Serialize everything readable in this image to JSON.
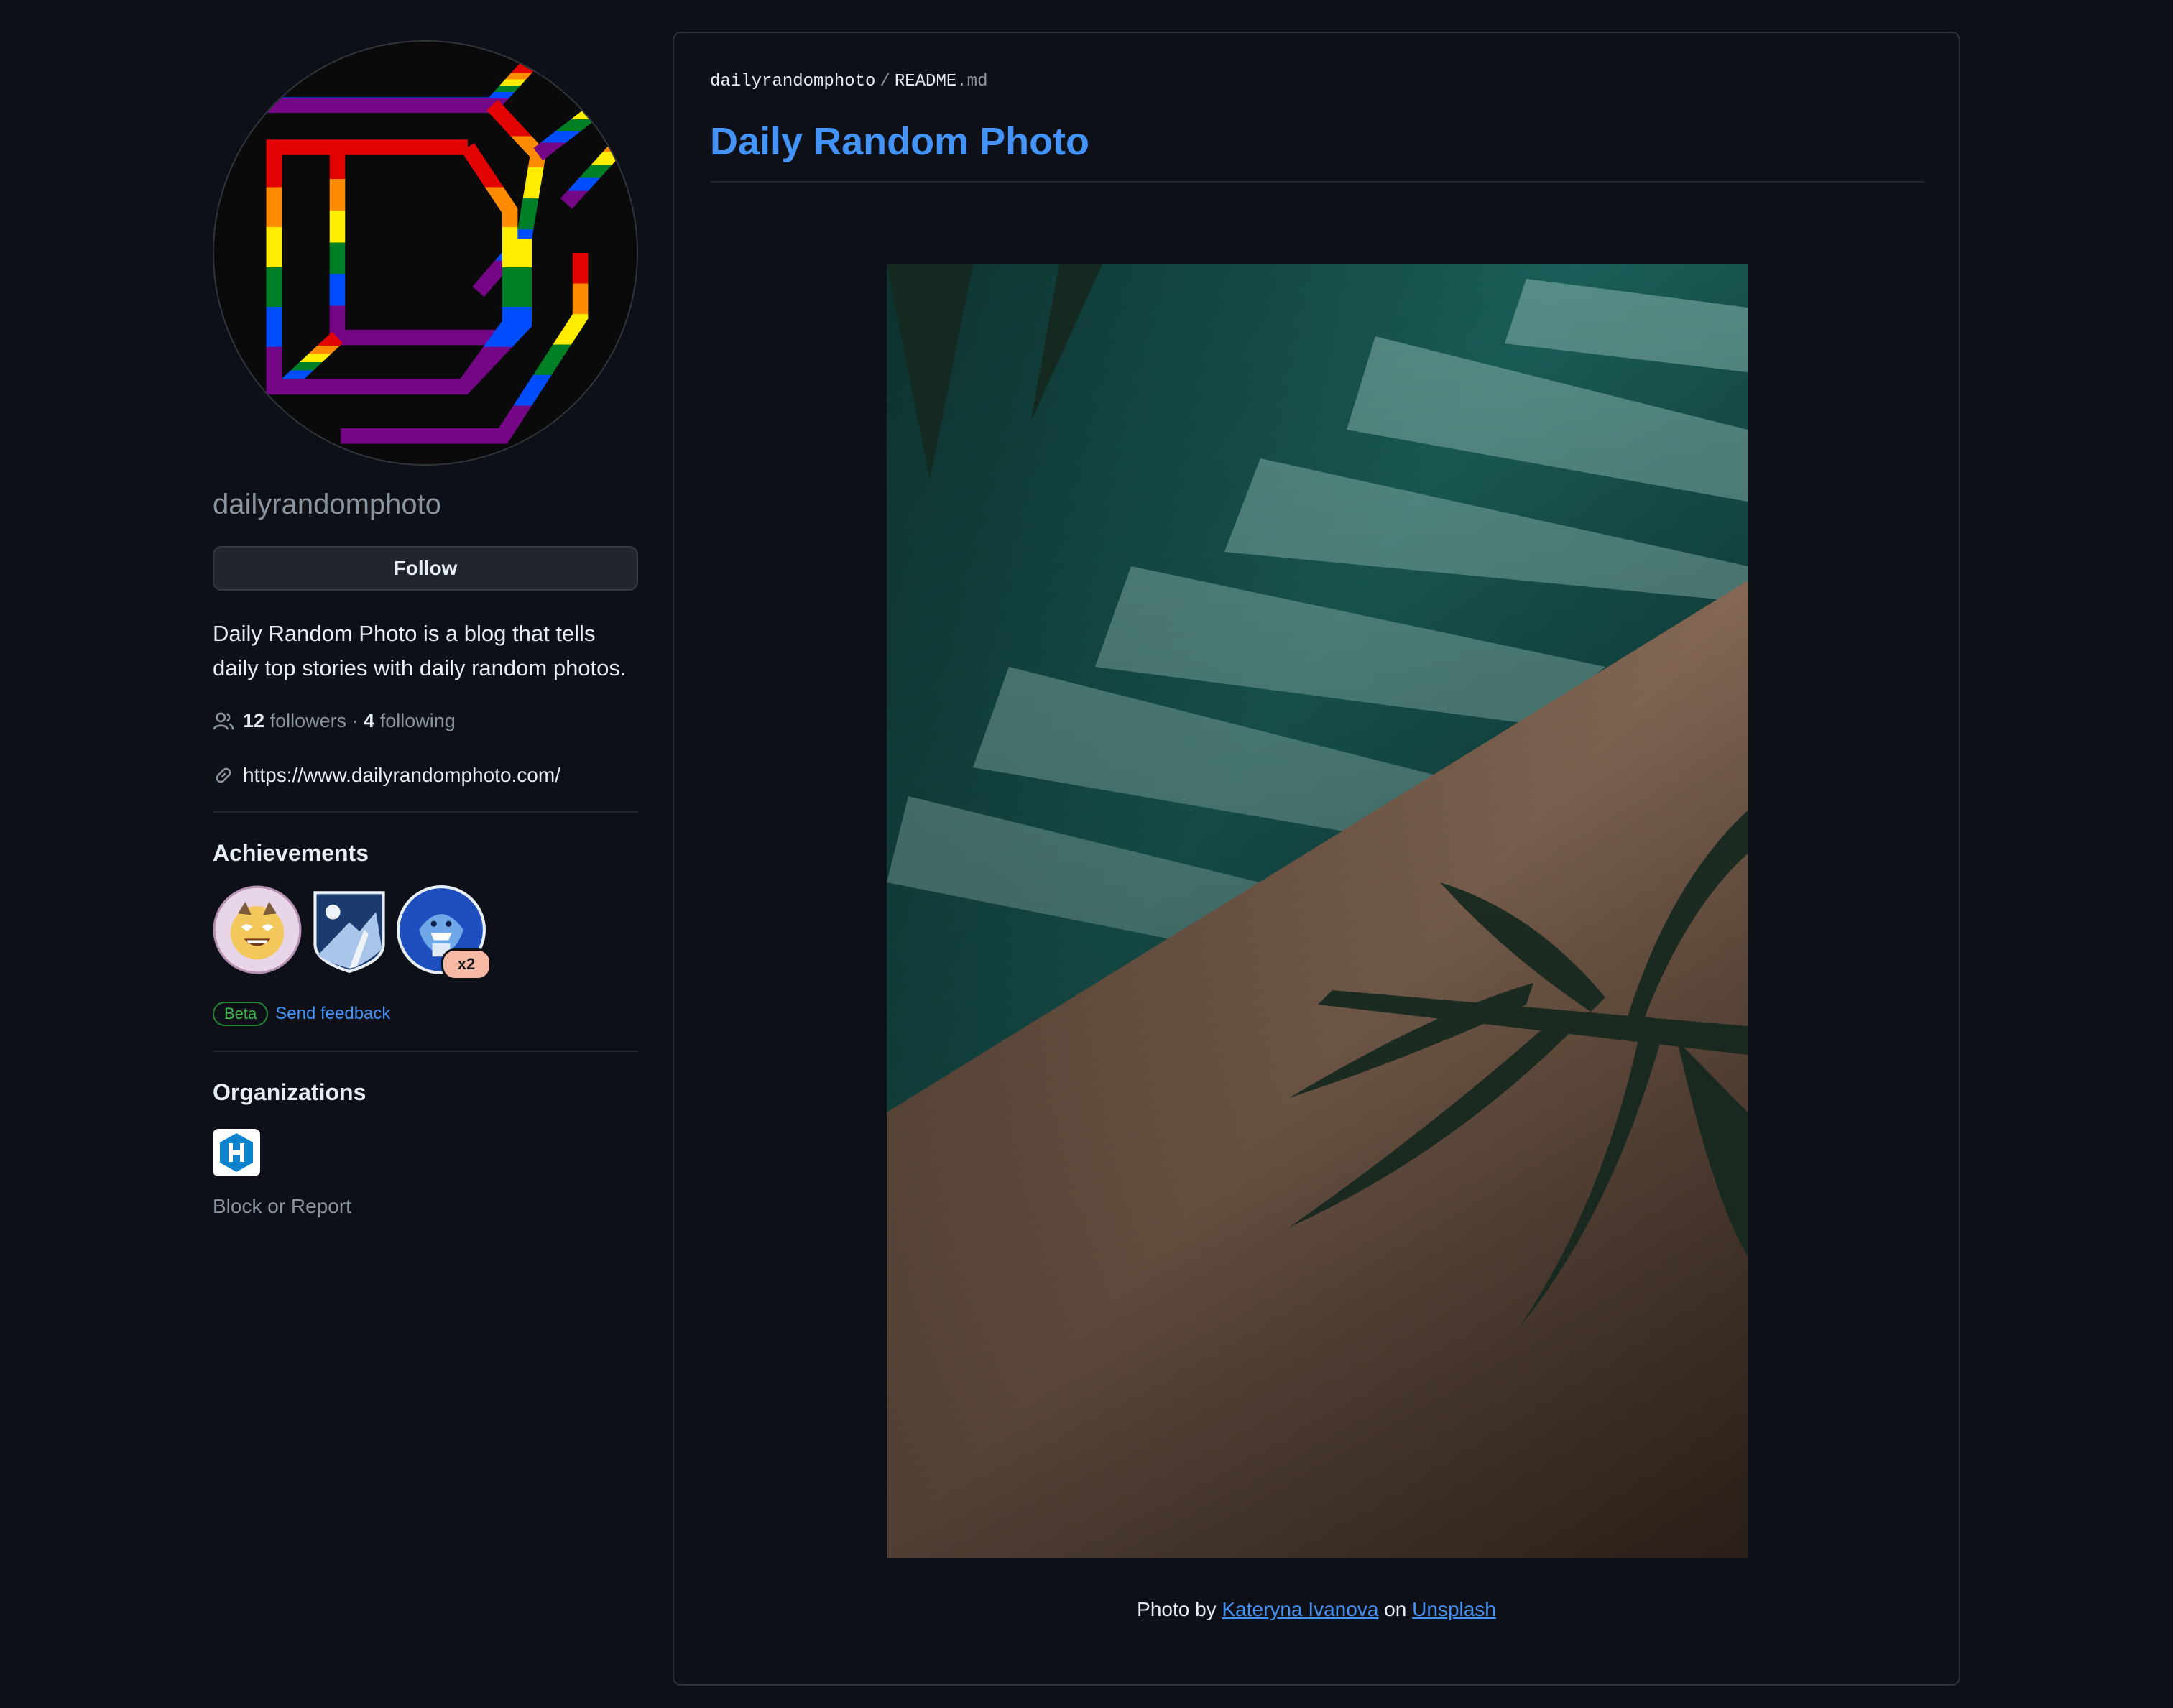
{
  "profile": {
    "username": "dailyrandomphoto",
    "follow_label": "Follow",
    "bio": "Daily Random Photo is a blog that tells daily top stories with daily random photos.",
    "followers_count": "12",
    "followers_label": "followers",
    "separator": "·",
    "following_count": "4",
    "following_label": "following",
    "blog_url": "https://www.dailyrandomphoto.com/"
  },
  "achievements": {
    "title": "Achievements",
    "badges": [
      "starstruck-badge",
      "arctic-code-vault-badge",
      "pull-shark-badge"
    ],
    "pull_shark_count": "x2",
    "beta_label": "Beta",
    "feedback_label": "Send feedback"
  },
  "organizations": {
    "title": "Organizations",
    "org_icon": "hexo-org-icon",
    "block_report_label": "Block or Report"
  },
  "readme": {
    "path_user": "dailyrandomphoto",
    "path_sep": "/",
    "path_file": "README",
    "path_ext": ".md",
    "title": "Daily Random Photo",
    "caption_prefix": "Photo by",
    "photographer": "Kateryna Ivanova",
    "caption_mid": "on",
    "source": "Unsplash"
  },
  "colors": {
    "background": "#0d1117",
    "link": "#4493f8",
    "muted": "#8b949e",
    "beta_green": "#3fb950"
  }
}
